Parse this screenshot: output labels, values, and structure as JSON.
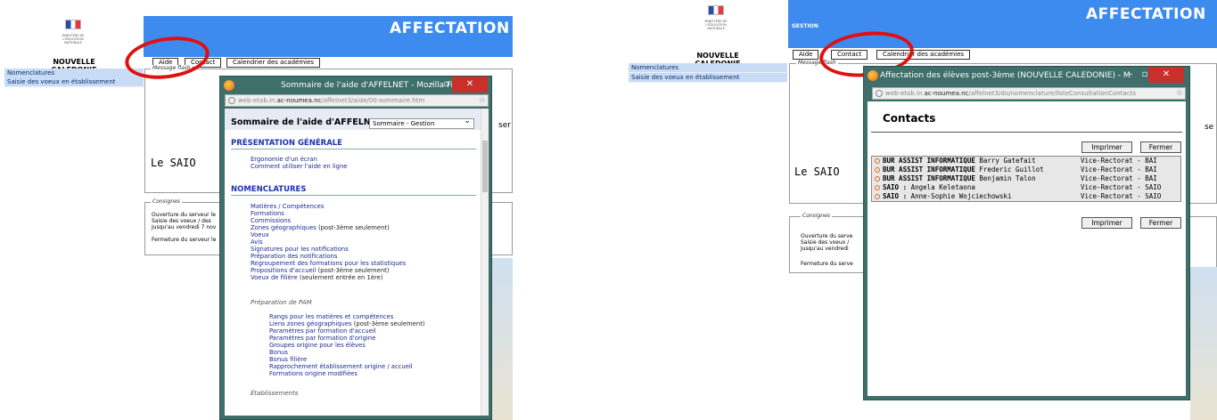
{
  "left": {
    "region": "NOUVELLE CALEDONIE",
    "ministry_text": "MINISTÈRE DE L'ÉDUCATION NATIONALE",
    "sidebar": [
      {
        "label": "Nomenclatures"
      },
      {
        "label": "Saisie des voeux en établissement"
      }
    ],
    "banner_title": "AFFECTATION",
    "toolbar": {
      "aide": "Aide",
      "contact": "Contact",
      "calendrier": "Calendrier des académies"
    },
    "message_flash": "Message flash",
    "saio": "Le SAIO",
    "consignes_legend": "Consignes",
    "consignes": [
      "Ouverture du serveur le",
      "Saisie des voeux / des",
      "Jusqu'au vendredi 7 nov",
      "",
      "Fermeture du serveur le"
    ],
    "cut_text": "ser"
  },
  "help_window": {
    "title": "Sommaire de l'aide d'AFFELNET - Mozilla Firefox",
    "url_prefix": "web-etab.in.",
    "url_domain": "ac-noumea.nc",
    "url_path": "/affelnet3/aide/00-sommaire.htm",
    "heading": "Sommaire de l'aide d'AFFELNET",
    "select_value": "Sommaire - Gestion",
    "section1": "PRÉSENTATION GÉNÉRALE",
    "section1_items": [
      "Ergonomie d'un écran",
      "Comment utiliser l'aide en ligne"
    ],
    "section2": "NOMENCLATURES",
    "section2_items": [
      {
        "link": "Matières / Compétences",
        "note": ""
      },
      {
        "link": "Formations",
        "note": ""
      },
      {
        "link": "Commissions",
        "note": ""
      },
      {
        "link": "Zones géographiques",
        "note": " (post-3ème seulement)"
      },
      {
        "link": "Voeux",
        "note": ""
      },
      {
        "link": "Avis",
        "note": ""
      },
      {
        "link": "Signatures pour les notifications",
        "note": ""
      },
      {
        "link": "Préparation des notifications",
        "note": ""
      },
      {
        "link": "Regroupement des formations pour les statistiques",
        "note": ""
      },
      {
        "link": "Propositions d'accueil",
        "note": " (post-3ème seulement)"
      },
      {
        "link": "Voeux de filière",
        "note": " (seulement entrée en 1ère)"
      }
    ],
    "pam_heading": "Préparation de PAM",
    "pam_items": [
      {
        "link": "Rangs pour les matières et compétences",
        "note": ""
      },
      {
        "link": "Liens zones géographiques",
        "note": " (post-3ème seulement)"
      },
      {
        "link": "Paramètres par formation d'accueil",
        "note": ""
      },
      {
        "link": "Paramètres par formation d'origine",
        "note": ""
      },
      {
        "link": "Groupes origine pour les élèves",
        "note": ""
      },
      {
        "link": "Bonus",
        "note": ""
      },
      {
        "link": "Bonus filière",
        "note": ""
      },
      {
        "link": "Rapprochement établissement origine / accueil",
        "note": ""
      },
      {
        "link": "Formations origine modifiées",
        "note": ""
      }
    ],
    "etab_heading": "Établissements"
  },
  "right": {
    "region": "NOUVELLE CALEDONIE",
    "ministry_text": "MINISTÈRE DE L'ÉDUCATION NATIONALE",
    "sidebar": [
      {
        "label": "Nomenclatures"
      },
      {
        "label": "Saisie des voeux en établissement"
      }
    ],
    "banner_title": "AFFECTATION",
    "banner_sub": "GESTION",
    "toolbar": {
      "aide": "Aide",
      "contact": "Contact",
      "calendrier": "Calendrier des académies"
    },
    "message_flash": "Message flash",
    "saio": "Le SAIO",
    "consignes_legend": "Consignes",
    "consignes": [
      "Ouverture du serve",
      "Saisie des voeux /",
      "Jusqu'au vendredi",
      "",
      "Fermeture du serve"
    ],
    "cut_text": "se"
  },
  "contacts_window": {
    "title": "Affectation des élèves post-3ème (NOUVELLE CALEDONIE) - M...",
    "url_prefix": "web-etab.in.",
    "url_domain": "ac-noumea.nc",
    "url_path": "/affelnet3/do/nomenclature/listeConsultationContacts",
    "heading": "Contacts",
    "print": "Imprimer",
    "close": "Fermer",
    "rows": [
      {
        "role": "BUR ASSIST INFORMATIQUE",
        "name": "Barry Gatefait",
        "org": "Vice-Rectorat - BAI"
      },
      {
        "role": "BUR ASSIST INFORMATIQUE",
        "name": "Frederic Guillot",
        "org": "Vice-Rectorat - BAI"
      },
      {
        "role": "BUR ASSIST INFORMATIQUE",
        "name": "Benjamin Talon",
        "org": "Vice-Rectorat - BAI"
      },
      {
        "role": "SAIO :",
        "name": "Angela Keletaona",
        "org": "Vice-Rectorat - SAIO"
      },
      {
        "role": "SAIO :",
        "name": "Anne-Sophie Wojciechowski",
        "org": "Vice-Rectorat - SAIO"
      }
    ]
  },
  "colors": {
    "banner": "#3d8bef",
    "sidebar": "#c8ddf5",
    "window": "#3e6f6a",
    "close": "#c9302c",
    "ring": "#e01010"
  }
}
